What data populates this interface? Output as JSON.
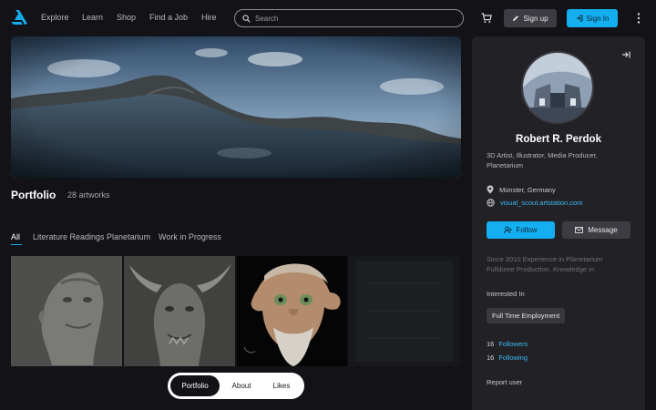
{
  "nav": {
    "links": [
      "Explore",
      "Learn",
      "Shop",
      "Find a Job",
      "Hire"
    ],
    "search_placeholder": "Search",
    "signup_label": "Sign up",
    "signin_label": "Sign In"
  },
  "portfolio": {
    "title": "Portfolio",
    "count": "28 artworks",
    "tabs": [
      "All",
      "Literature Readings Planetarium",
      "Work in Progress"
    ],
    "active_tab": "All"
  },
  "bottom_nav": {
    "items": [
      "Portfolio",
      "About",
      "Likes"
    ],
    "active": "Portfolio"
  },
  "profile": {
    "name": "Robert R. Perdok",
    "headline": "3D Artist, Illustrator, Media Producer, Planetarium",
    "location": "Münster, Germany",
    "website": "visual_scout.artstation.com",
    "follow_label": "Follow",
    "message_label": "Message",
    "summary": "Since 2010 Experience in Planetarium Fulldome Production. Knowledge in",
    "interested_label": "Interested In",
    "interest_chip": "Full Time Employment",
    "followers_count": "16",
    "followers_label": "Followers",
    "following_count": "16",
    "following_label": "Following",
    "report_label": "Report user"
  },
  "colors": {
    "background": "#131317",
    "panel": "#222226",
    "accent": "#13aff0",
    "link": "#3cb9f2"
  },
  "icons": [
    "artstation-logo-icon",
    "search-icon",
    "cart-icon",
    "pencil-icon",
    "sign-in-icon",
    "kebab-menu-icon",
    "collapse-panel-icon",
    "location-pin-icon",
    "globe-icon",
    "add-user-icon",
    "mail-icon"
  ]
}
